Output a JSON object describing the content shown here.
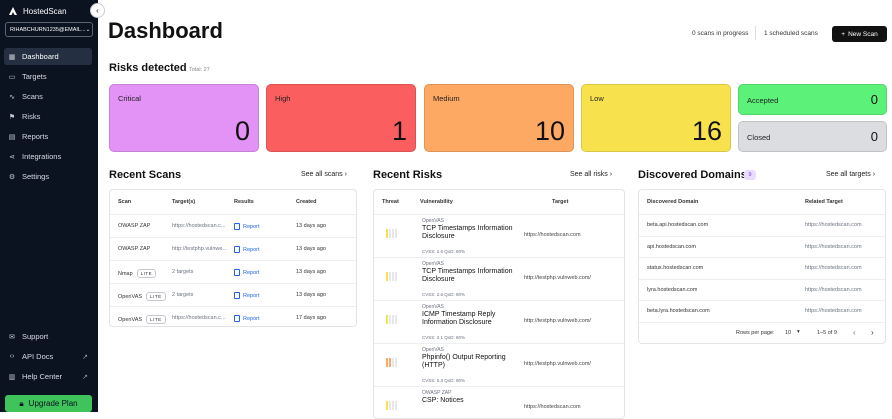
{
  "app": {
    "name": "HostedScan",
    "account": "RIHABCHURN1235@EMAIL...",
    "upgrade_label": "Upgrade Plan"
  },
  "nav": {
    "items": [
      {
        "label": "Dashboard",
        "icon": "grid-icon",
        "active": true
      },
      {
        "label": "Targets",
        "icon": "targets-icon"
      },
      {
        "label": "Scans",
        "icon": "pulse-icon"
      },
      {
        "label": "Risks",
        "icon": "flag-icon"
      },
      {
        "label": "Reports",
        "icon": "reports-icon"
      },
      {
        "label": "Integrations",
        "icon": "integrations-icon"
      },
      {
        "label": "Settings",
        "icon": "gear-icon"
      }
    ],
    "bottom": [
      {
        "label": "Support",
        "icon": "mail-icon"
      },
      {
        "label": "API Docs",
        "icon": "code-icon",
        "external": true
      },
      {
        "label": "Help Center",
        "icon": "book-icon",
        "external": true
      }
    ]
  },
  "header": {
    "title": "Dashboard",
    "scans_in_progress": "0 scans in progress",
    "scheduled_scans": "1 scheduled scans",
    "new_scan_label": "New Scan"
  },
  "risks": {
    "title": "Risks detected",
    "total": "Total: 27",
    "cards": [
      {
        "label": "Critical",
        "count": "0",
        "color": "#e293f5"
      },
      {
        "label": "High",
        "count": "1",
        "color": "#fb5e5e"
      },
      {
        "label": "Medium",
        "count": "10",
        "color": "#fda963"
      },
      {
        "label": "Low",
        "count": "16",
        "color": "#f7e24e"
      }
    ],
    "accepted": {
      "label": "Accepted",
      "count": "0",
      "color": "#5cf27a"
    },
    "closed": {
      "label": "Closed",
      "count": "0",
      "color": "#dcdde0"
    }
  },
  "recent_scans": {
    "title": "Recent Scans",
    "see_all": "See all scans",
    "columns": [
      "Scan",
      "Target(s)",
      "Results",
      "Created"
    ],
    "rows": [
      {
        "scan": "OWASP ZAP",
        "badge": "",
        "target": "https://hostedscan.c...",
        "result": "Report",
        "created": "13 days ago"
      },
      {
        "scan": "OWASP ZAP",
        "badge": "",
        "target": "http://testphp.vulnwe...",
        "result": "Report",
        "created": "13 days ago"
      },
      {
        "scan": "Nmap",
        "badge": "LITE",
        "target": "2 targets",
        "result": "Report",
        "created": "13 days ago"
      },
      {
        "scan": "OpenVAS",
        "badge": "LITE",
        "target": "2 targets",
        "result": "Report",
        "created": "13 days ago"
      },
      {
        "scan": "OpenVAS",
        "badge": "LITE",
        "target": "https://hostedscan.c...",
        "result": "Report",
        "created": "17 days ago"
      }
    ]
  },
  "recent_risks": {
    "title": "Recent Risks",
    "see_all": "See all risks",
    "columns": [
      "Threat",
      "Vulnerability",
      "Target"
    ],
    "rows": [
      {
        "level": 1,
        "source": "OpenVAS",
        "name": "TCP Timestamps Information Disclosure",
        "meta": "CVSS: 2.6   QoD: 80%",
        "target": "https://hostedscan.com"
      },
      {
        "level": 1,
        "source": "OpenVAS",
        "name": "TCP Timestamps Information Disclosure",
        "meta": "CVSS: 2.6   QoD: 80%",
        "target": "http://testphp.vulnweb.com/"
      },
      {
        "level": 1,
        "source": "OpenVAS",
        "name": "ICMP Timestamp Reply Information Disclosure",
        "meta": "CVSS: 2.1   QoD: 80%",
        "target": "http://testphp.vulnweb.com/"
      },
      {
        "level": 2,
        "source": "OpenVAS",
        "name": "Phpinfo() Output Reporting (HTTP)",
        "meta": "CVSS: 5.3   QoD: 80%",
        "target": "http://testphp.vulnweb.com/"
      },
      {
        "level": 1,
        "source": "OWASP ZAP",
        "name": "CSP: Notices",
        "meta": "",
        "target": "https://hostedscan.com"
      }
    ]
  },
  "domains": {
    "title": "Discovered Domains",
    "count": "9",
    "see_all": "See all targets",
    "columns": [
      "Discovered Domain",
      "Related Target"
    ],
    "rows": [
      {
        "domain": "beta.api.hostedscan.com",
        "target": "https://hostedscan.com"
      },
      {
        "domain": "api.hostedscan.com",
        "target": "https://hostedscan.com"
      },
      {
        "domain": "status.hostedscan.com",
        "target": "https://hostedscan.com"
      },
      {
        "domain": "lyra.hostedscan.com",
        "target": "https://hostedscan.com"
      },
      {
        "domain": "beta.lyra.hostedscan.com",
        "target": "https://hostedscan.com"
      }
    ],
    "rows_per_page_label": "Rows per page:",
    "rows_per_page": "10",
    "range": "1–5 of 9"
  }
}
